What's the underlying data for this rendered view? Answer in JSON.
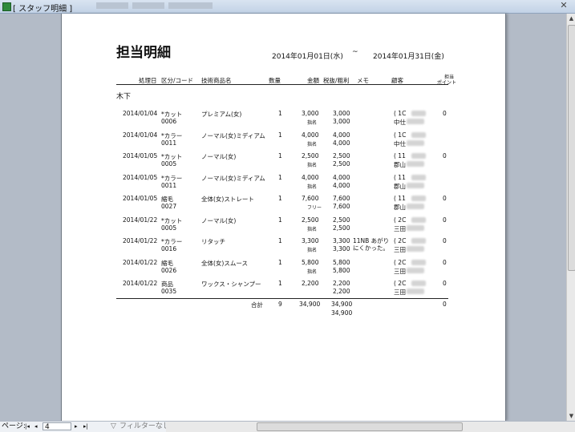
{
  "window": {
    "title": "[ スタッフ明細 ]",
    "close": "✕"
  },
  "report": {
    "title": "担当明細",
    "date_from": "2014年01月01日(水)",
    "tilde": "~",
    "date_to": "2014年01月31日(金)",
    "headers": {
      "date": "処理日",
      "category_code": "区分/コード",
      "product": "技術商品名",
      "qty": "数量",
      "amount": "金額",
      "tax": "税抜/粗利",
      "memo": "メモ",
      "customer": "顧客",
      "points_1": "担当",
      "points_2": "ポイント"
    },
    "staff": "木下",
    "rows": [
      {
        "date": "2014/01/04",
        "cat": "*カット",
        "code": "0006",
        "product": "プレミアム(女)",
        "qty": "1",
        "amount": "3,000",
        "sub": "指名",
        "tax": "3,000",
        "profit": "3,000",
        "memo": "",
        "cust_open": "( 1C",
        "cust_name": "中仕",
        "points": "0"
      },
      {
        "date": "2014/01/04",
        "cat": "*カラー",
        "code": "0011",
        "product": "ノーマル(女)ミディアム",
        "qty": "1",
        "amount": "4,000",
        "sub": "指名",
        "tax": "4,000",
        "profit": "4,000",
        "memo": "",
        "cust_open": "( 1C",
        "cust_name": "中仕",
        "points": ""
      },
      {
        "date": "2014/01/05",
        "cat": "*カット",
        "code": "0005",
        "product": "ノーマル(女)",
        "qty": "1",
        "amount": "2,500",
        "sub": "指名",
        "tax": "2,500",
        "profit": "2,500",
        "memo": "",
        "cust_open": "( 11",
        "cust_name": "郡山",
        "points": "0"
      },
      {
        "date": "2014/01/05",
        "cat": "*カラー",
        "code": "0011",
        "product": "ノーマル(女)ミディアム",
        "qty": "1",
        "amount": "4,000",
        "sub": "指名",
        "tax": "4,000",
        "profit": "4,000",
        "memo": "",
        "cust_open": "( 11",
        "cust_name": "郡山",
        "points": ""
      },
      {
        "date": "2014/01/05",
        "cat": "縮毛",
        "code": "0027",
        "product": "全体(女)ストレート",
        "qty": "1",
        "amount": "7,600",
        "sub": "フリー",
        "tax": "7,600",
        "profit": "7,600",
        "memo": "",
        "cust_open": "( 11",
        "cust_name": "郡山",
        "points": "0"
      },
      {
        "date": "2014/01/22",
        "cat": "*カット",
        "code": "0005",
        "product": "ノーマル(女)",
        "qty": "1",
        "amount": "2,500",
        "sub": "指名",
        "tax": "2,500",
        "profit": "2,500",
        "memo": "",
        "cust_open": "( 2C",
        "cust_name": "三田",
        "points": "0"
      },
      {
        "date": "2014/01/22",
        "cat": "*カラー",
        "code": "0016",
        "product": "リタッチ",
        "qty": "1",
        "amount": "3,300",
        "sub": "指名",
        "tax": "3,300",
        "profit": "3,300",
        "memo": "11NB あがり\nにくかった。",
        "cust_open": "( 2C",
        "cust_name": "三田",
        "points": "0"
      },
      {
        "date": "2014/01/22",
        "cat": "縮毛",
        "code": "0026",
        "product": "全体(女)スムース",
        "qty": "1",
        "amount": "5,800",
        "sub": "指名",
        "tax": "5,800",
        "profit": "5,800",
        "memo": "",
        "cust_open": "( 2C",
        "cust_name": "三田",
        "points": "0"
      },
      {
        "date": "2014/01/22",
        "cat": "商品",
        "code": "0035",
        "product": "ワックス・シャンプー",
        "qty": "1",
        "amount": "2,200",
        "sub": "",
        "tax": "2,200",
        "profit": "2,200",
        "memo": "",
        "cust_open": "( 2C",
        "cust_name": "三田",
        "points": "0"
      }
    ],
    "total": {
      "label": "合計",
      "qty": "9",
      "amount": "34,900",
      "tax": "34,900",
      "profit": "34,900",
      "points": "0"
    }
  },
  "statusbar": {
    "page_label": "ページ:",
    "first": "|◂",
    "prev": "◂",
    "page_value": "4",
    "next": "▸",
    "last": "▸|",
    "filter_icon": "filter-icon",
    "filter": "フィルターなし"
  }
}
